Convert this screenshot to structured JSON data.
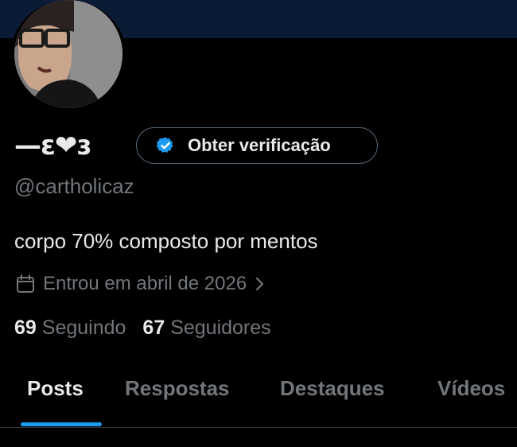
{
  "profile": {
    "display_name": "—ɛ❤ɜ",
    "handle": "@cartholicaz",
    "bio": "corpo 70% composto por mentos",
    "joined": "Entrou em abril de 2026"
  },
  "verification": {
    "label": "Obter verificação"
  },
  "stats": {
    "following_count": "69",
    "following_label": "Seguindo",
    "followers_count": "67",
    "followers_label": "Seguidores"
  },
  "tabs": [
    {
      "label": "Posts",
      "active": true
    },
    {
      "label": "Respostas"
    },
    {
      "label": "Destaques"
    },
    {
      "label": "Vídeos"
    }
  ],
  "icons": {
    "verify": "verified-badge-icon",
    "calendar": "calendar-icon",
    "chevron": "chevron-right-icon"
  },
  "colors": {
    "background": "#000000",
    "banner": "#0b1a35",
    "accent": "#1d9bf0",
    "text_primary": "#e7e9ea",
    "text_secondary": "#71767b",
    "border": "#536471"
  }
}
